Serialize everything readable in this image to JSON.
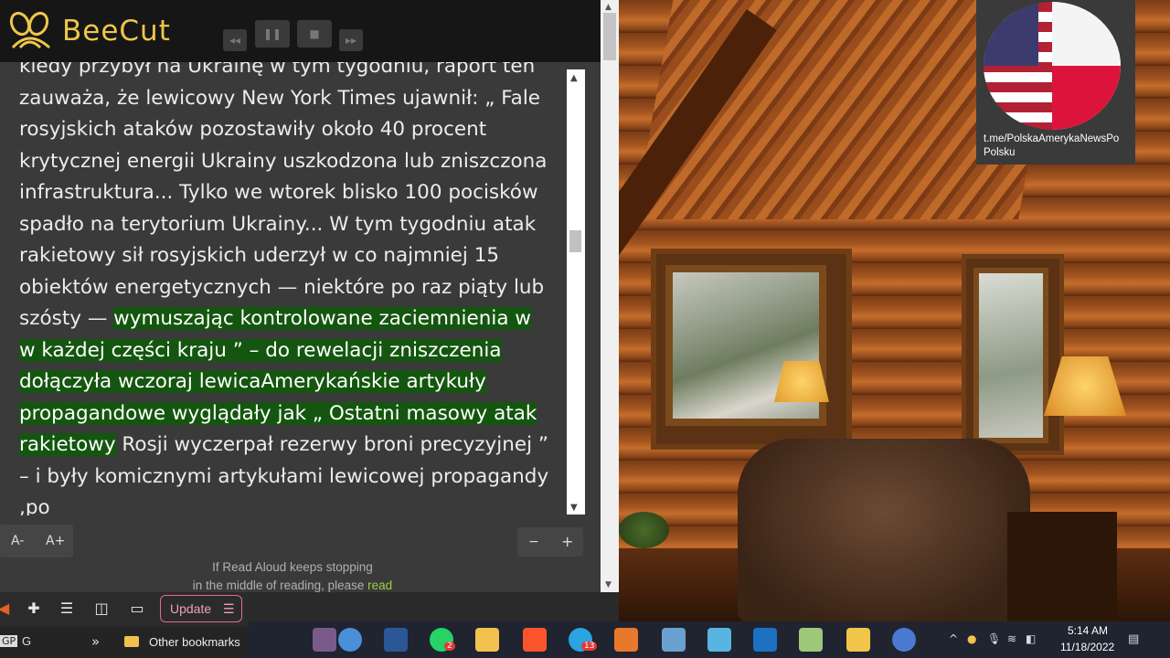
{
  "app": {
    "name": "BeeCut",
    "brand_color": "#f0c54a"
  },
  "player": {
    "rewind_label": "◂◂",
    "pause_label": "❚❚",
    "stop_label": "■",
    "forward_label": "▸▸"
  },
  "reader": {
    "text_prefix": "kiedy przybył na Ukrainę w tym tygodniu, raport ten zauważa, że lewicowy New York Times ujawnił: „ Fale rosyjskich ataków pozostawiły około 40 procent krytycznej energii Ukrainy uszkodzona lub zniszczona infrastruktura... Tylko we wtorek blisko 100 pocisków spadło na terytorium Ukrainy... W tym tygodniu atak rakietowy sił rosyjskich uderzył w co najmniej 15 obiektów energetycznych — niektóre po raz piąty lub szósty — ",
    "text_highlight": "wymuszając kontrolowane zaciemnienia w w każdej części kraju ” – do rewelacji zniszczenia dołączyła wczoraj lewicaAmerykańskie artykuły propagandowe wyglądały jak „ Ostatni masowy atak rakietowy",
    "text_suffix": " Rosji wyczerpał rezerwy broni precyzyjnej ” – i były komicznymi artykułami lewicowej propagandy ,po",
    "highlight_color": "#14560f",
    "font_decrease": "A-",
    "font_increase": "A+",
    "zoom_out": "−",
    "zoom_in": "+",
    "notice_line1": "If Read Aloud keeps stopping",
    "notice_line2": "in the middle of reading, please ",
    "notice_link": "read"
  },
  "badge": {
    "caption": "t.me/PolskaAmerykaNewsPo Polsku"
  },
  "browser": {
    "update_label": "Update",
    "update_menu": "☰",
    "bookmark_gp": "GP",
    "bookmark_g": "G",
    "more": "»",
    "other_bookmarks": "Other bookmarks"
  },
  "taskbar": {
    "time": "5:14 AM",
    "date": "11/18/2022",
    "telegram_badge": "13",
    "whatsapp_badge": "2"
  }
}
